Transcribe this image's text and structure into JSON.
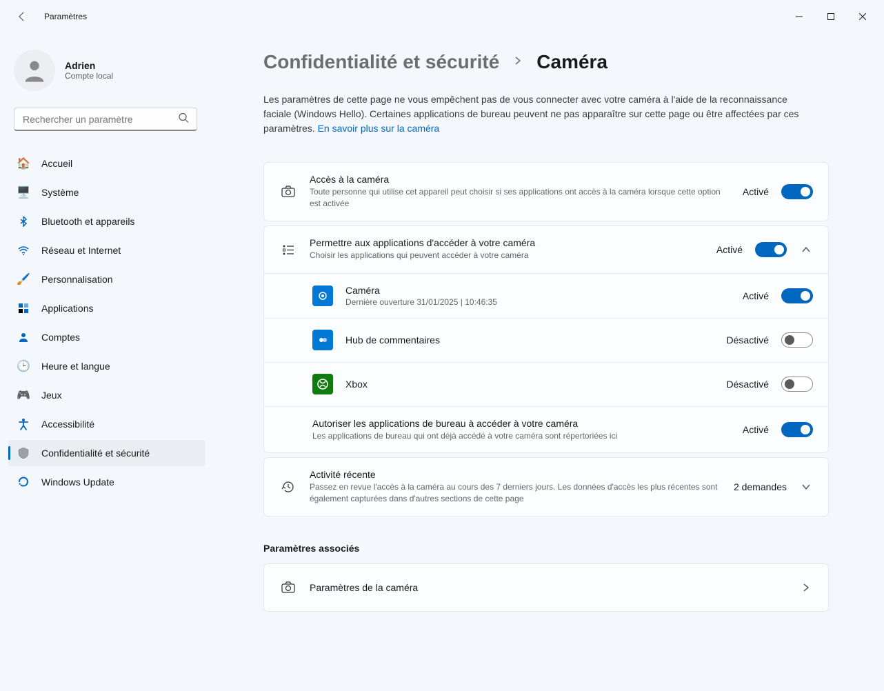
{
  "titlebar": {
    "title": "Paramètres"
  },
  "profile": {
    "name": "Adrien",
    "sub": "Compte local"
  },
  "search": {
    "placeholder": "Rechercher un paramètre"
  },
  "nav": {
    "home": "Accueil",
    "system": "Système",
    "bluetooth": "Bluetooth et appareils",
    "network": "Réseau et Internet",
    "personalization": "Personnalisation",
    "apps": "Applications",
    "accounts": "Comptes",
    "time": "Heure et langue",
    "gaming": "Jeux",
    "accessibility": "Accessibilité",
    "privacy": "Confidentialité et sécurité",
    "update": "Windows Update"
  },
  "breadcrumb": {
    "parent": "Confidentialité et sécurité",
    "current": "Caméra"
  },
  "intro": {
    "text": "Les paramètres de cette page ne vous empêchent pas de vous connecter avec votre caméra à l'aide de la reconnaissance faciale (Windows Hello). Certaines applications de bureau peuvent ne pas apparaître sur cette page ou être affectées par ces paramètres.  ",
    "link": "En savoir plus sur la caméra"
  },
  "access": {
    "title": "Accès à la caméra",
    "sub": "Toute personne qui utilise cet appareil peut choisir si ses applications ont accès à la caméra lorsque cette option est activée",
    "status": "Activé"
  },
  "allow_apps": {
    "title": "Permettre aux applications d'accéder à votre caméra",
    "sub": "Choisir les applications qui peuvent accéder à votre caméra",
    "status": "Activé"
  },
  "apps": {
    "camera": {
      "title": "Caméra",
      "sub": "Dernière ouverture 31/01/2025  |  10:46:35",
      "status": "Activé"
    },
    "feedback": {
      "title": "Hub de commentaires",
      "status": "Désactivé"
    },
    "xbox": {
      "title": "Xbox",
      "status": "Désactivé"
    }
  },
  "desktop": {
    "title": "Autoriser les applications de bureau à accéder à votre caméra",
    "sub": "Les applications de bureau qui ont déjà accédé à votre caméra sont répertoriées ici",
    "status": "Activé"
  },
  "activity": {
    "title": "Activité récente",
    "sub": "Passez en revue l'accès à la caméra au cours des 7 derniers jours. Les données d'accès les plus récentes sont également capturées dans d'autres sections de cette page",
    "count": "2 demandes"
  },
  "related": {
    "heading": "Paramètres associés",
    "camera_settings": "Paramètres de la caméra"
  }
}
